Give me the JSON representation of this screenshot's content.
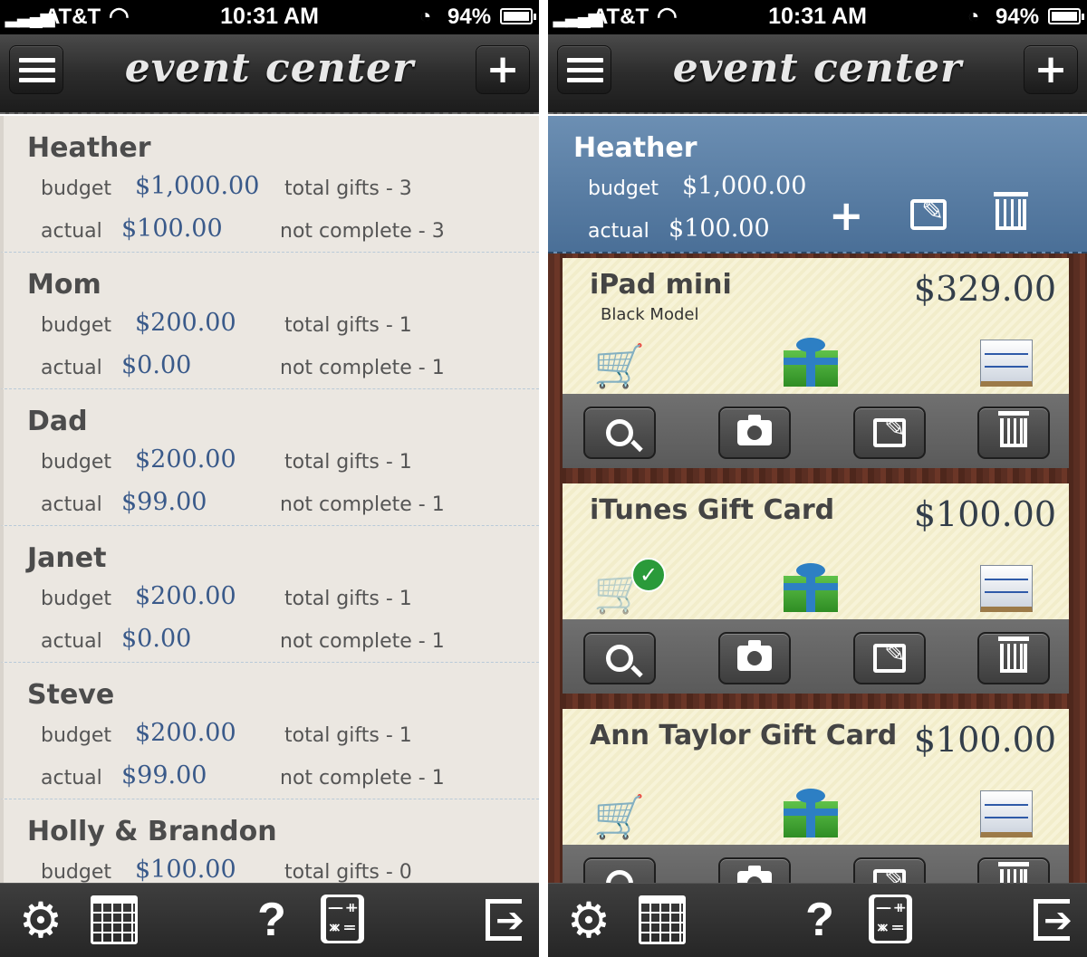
{
  "status_bar": {
    "carrier": "AT&T",
    "time": "10:31 AM",
    "battery": "94%",
    "battery_level": 0.94
  },
  "nav": {
    "title": "event center",
    "menu_icon": "hamburger-menu-icon",
    "add_icon": "plus-icon"
  },
  "tab_bar": {
    "icons": [
      "gear-icon",
      "calendar-icon",
      "help-icon",
      "calculator-icon",
      "exit-icon"
    ],
    "help_glyph": "?"
  },
  "left": {
    "labels": {
      "budget": "budget",
      "actual": "actual"
    },
    "people": [
      {
        "name": "Heather",
        "budget": "$1,000.00",
        "actual": "$100.00",
        "total_gifts": "total gifts - 3",
        "not_complete": "not complete - 3"
      },
      {
        "name": "Mom",
        "budget": "$200.00",
        "actual": "$0.00",
        "total_gifts": "total gifts - 1",
        "not_complete": "not complete - 1"
      },
      {
        "name": "Dad",
        "budget": "$200.00",
        "actual": "$99.00",
        "total_gifts": "total gifts - 1",
        "not_complete": "not complete - 1"
      },
      {
        "name": "Janet",
        "budget": "$200.00",
        "actual": "$0.00",
        "total_gifts": "total gifts - 1",
        "not_complete": "not complete - 1"
      },
      {
        "name": "Steve",
        "budget": "$200.00",
        "actual": "$99.00",
        "total_gifts": "total gifts - 1",
        "not_complete": "not complete - 1"
      },
      {
        "name": "Holly & Brandon",
        "budget": "$100.00",
        "actual": "",
        "total_gifts": "total gifts - 0",
        "not_complete": ""
      }
    ]
  },
  "right": {
    "header": {
      "name": "Heather",
      "budget_label": "budget",
      "budget": "$1,000.00",
      "actual_label": "actual",
      "actual": "$100.00",
      "plus_glyph": "+"
    },
    "gifts": [
      {
        "title": "iPad mini",
        "subtitle": "Black Model",
        "price": "$329.00",
        "purchased": false
      },
      {
        "title": "iTunes Gift Card",
        "subtitle": "",
        "price": "$100.00",
        "purchased": true
      },
      {
        "title": "Ann Taylor Gift Card",
        "subtitle": "",
        "price": "$100.00",
        "purchased": false
      }
    ]
  },
  "colors": {
    "accent_blue": "#3a5a8a",
    "header_blue": "#5b80a8",
    "list_bg": "#ebe7e1",
    "card_bg": "#f7f3d8",
    "check_green": "#2a9a3a"
  }
}
